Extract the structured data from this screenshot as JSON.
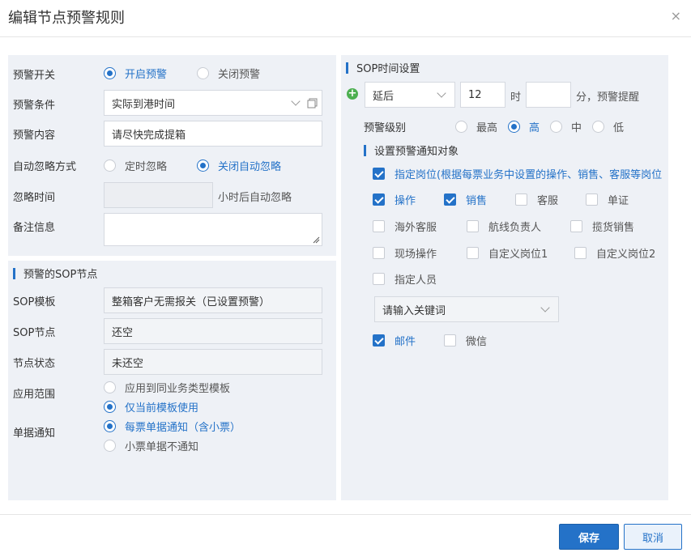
{
  "dialog": {
    "title": "编辑节点预警规则",
    "close": "×"
  },
  "left": {
    "alert_switch": {
      "label": "预警开关",
      "on": "开启预警",
      "off": "关闭预警"
    },
    "alert_condition": {
      "label": "预警条件",
      "value": "实际到港时间"
    },
    "alert_content": {
      "label": "预警内容",
      "value": "请尽快完成提箱"
    },
    "auto_ignore": {
      "label": "自动忽略方式",
      "opt_timed": "定时忽略",
      "opt_off": "关闭自动忽略"
    },
    "ignore_time": {
      "label": "忽略时间",
      "value": "",
      "suffix": "小时后自动忽略"
    },
    "remark": {
      "label": "备注信息",
      "value": ""
    },
    "sop_section": {
      "title": "预警的SOP节点"
    },
    "sop_template": {
      "label": "SOP模板",
      "value": "整箱客户无需报关（已设置预警）"
    },
    "sop_node": {
      "label": "SOP节点",
      "value": "还空"
    },
    "node_status": {
      "label": "节点状态",
      "value": "未还空"
    },
    "scope": {
      "label": "应用范围",
      "opt1": "应用到同业务类型模板",
      "opt2": "仅当前模板使用"
    },
    "notify": {
      "label": "单据通知",
      "opt1": "每票单据通知（含小票）",
      "opt2": "小票单据不通知"
    }
  },
  "right": {
    "sop_time": {
      "title": "SOP时间设置",
      "mode": "延后",
      "hours": "12",
      "hour_unit": "时",
      "minutes": "",
      "minute_suffix": "分，预警提醒"
    },
    "level": {
      "label": "预警级别",
      "highest": "最高",
      "high": "高",
      "mid": "中",
      "low": "低"
    },
    "targets": {
      "title": "设置预警通知对象",
      "assigned_role": "指定岗位(根据每票业务中设置的操作、销售、客服等岗位",
      "operation": "操作",
      "sales": "销售",
      "cs": "客服",
      "docs": "单证",
      "overseas_cs": "海外客服",
      "route_owner": "航线负责人",
      "cargo_sales": "揽货销售",
      "site_op": "现场操作",
      "custom1": "自定义岗位1",
      "custom2": "自定义岗位2",
      "assigned_person": "指定人员",
      "keyword_placeholder": "请输入关键词",
      "email": "邮件",
      "wechat": "微信"
    }
  },
  "footer": {
    "save": "保存",
    "cancel": "取消"
  },
  "colors": {
    "accent": "#2472c8",
    "panel": "#eef1f6",
    "add": "#4caf50"
  }
}
